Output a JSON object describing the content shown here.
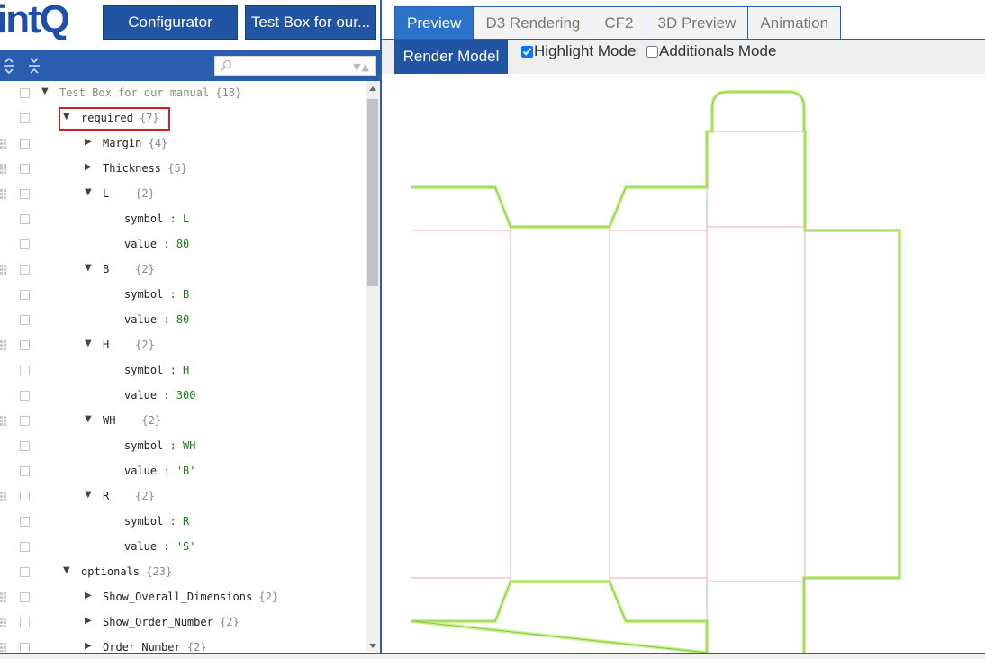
{
  "header": {
    "logo_text": "intQ",
    "configurator_label": "Configurator",
    "project_label": "Test Box for our..."
  },
  "tree_toolbar": {
    "expand_icon": "expand-all-icon",
    "collapse_icon": "collapse-all-icon",
    "search_placeholder": "",
    "search_icon": "search-icon"
  },
  "tree": {
    "rows": [
      {
        "indent": 0,
        "toggle": "▼",
        "key": "Test Box for our manual",
        "count": "{18}",
        "drag": false,
        "root": true
      },
      {
        "indent": 1,
        "toggle": "▼",
        "key": "required",
        "count": "{7}",
        "drag": false,
        "highlight": true
      },
      {
        "indent": 2,
        "toggle": "▶",
        "key": "Margin",
        "count": "{4}",
        "drag": true
      },
      {
        "indent": 2,
        "toggle": "▶",
        "key": "Thickness",
        "count": "{5}",
        "drag": true
      },
      {
        "indent": 2,
        "toggle": "▼",
        "key": "L",
        "count": "{2}",
        "drag": true
      },
      {
        "indent": 3,
        "key": "symbol",
        "value": "L",
        "drag": false
      },
      {
        "indent": 3,
        "key": "value",
        "value": "80",
        "drag": false
      },
      {
        "indent": 2,
        "toggle": "▼",
        "key": "B",
        "count": "{2}",
        "drag": true
      },
      {
        "indent": 3,
        "key": "symbol",
        "value": "B",
        "drag": false
      },
      {
        "indent": 3,
        "key": "value",
        "value": "80",
        "drag": false
      },
      {
        "indent": 2,
        "toggle": "▼",
        "key": "H",
        "count": "{2}",
        "drag": true
      },
      {
        "indent": 3,
        "key": "symbol",
        "value": "H",
        "drag": false
      },
      {
        "indent": 3,
        "key": "value",
        "value": "300",
        "drag": false
      },
      {
        "indent": 2,
        "toggle": "▼",
        "key": "WH",
        "count": "{2}",
        "drag": true
      },
      {
        "indent": 3,
        "key": "symbol",
        "value": "WH",
        "drag": false
      },
      {
        "indent": 3,
        "key": "value",
        "value": "'B'",
        "drag": false
      },
      {
        "indent": 2,
        "toggle": "▼",
        "key": "R",
        "count": "{2}",
        "drag": true
      },
      {
        "indent": 3,
        "key": "symbol",
        "value": "R",
        "drag": false
      },
      {
        "indent": 3,
        "key": "value",
        "value": "'S'",
        "drag": false
      },
      {
        "indent": 1,
        "toggle": "▼",
        "key": "optionals",
        "count": "{23}",
        "drag": false
      },
      {
        "indent": 2,
        "toggle": "▶",
        "key": "Show_Overall_Dimensions",
        "count": "{2}",
        "drag": true
      },
      {
        "indent": 2,
        "toggle": "▶",
        "key": "Show_Order_Number",
        "count": "{2}",
        "drag": true
      },
      {
        "indent": 2,
        "toggle": "▶",
        "key": "Order_Number",
        "count": "{2}",
        "drag": true
      }
    ]
  },
  "tabs": [
    {
      "label": "Preview",
      "active": true
    },
    {
      "label": "D3 Rendering",
      "active": false
    },
    {
      "label": "CF2",
      "active": false
    },
    {
      "label": "3D Preview",
      "active": false
    },
    {
      "label": "Animation",
      "active": false
    }
  ],
  "toolbar": {
    "render_label": "Render Model",
    "highlight_label": "Highlight Mode",
    "highlight_checked": true,
    "additionals_label": "Additionals Mode",
    "additionals_checked": false
  },
  "colors": {
    "brand_blue": "#2154a3",
    "tab_active": "#2a73c9",
    "cut_line": "#aeea6e",
    "fold_line": "#f0a0a8",
    "highlight_box": "#d42020",
    "value_green": "#1a7f1a"
  }
}
